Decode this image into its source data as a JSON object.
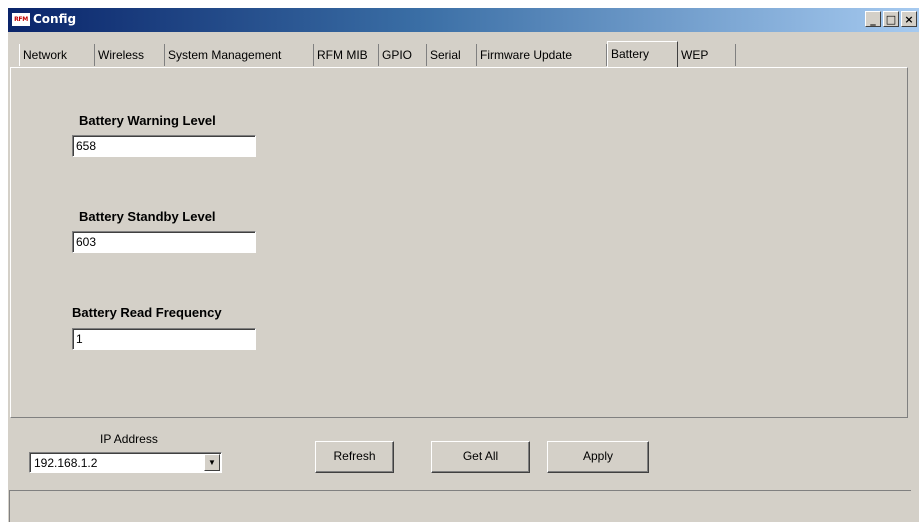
{
  "window": {
    "title": "Config",
    "app_icon_text": "RFM",
    "controls": {
      "minimize": "_",
      "maximize": "□",
      "close": "×"
    }
  },
  "tabs": [
    {
      "label": "Network",
      "active": false
    },
    {
      "label": "Wireless",
      "active": false
    },
    {
      "label": "System Management",
      "active": false
    },
    {
      "label": "RFM MIB",
      "active": false
    },
    {
      "label": "GPIO",
      "active": false
    },
    {
      "label": "Serial",
      "active": false
    },
    {
      "label": "Firmware Update",
      "active": false
    },
    {
      "label": "Battery",
      "active": true
    },
    {
      "label": "WEP",
      "active": false
    }
  ],
  "battery": {
    "warning": {
      "label": "Battery Warning Level",
      "value": "658"
    },
    "standby": {
      "label": "Battery Standby Level",
      "value": "603"
    },
    "frequency": {
      "label": "Battery Read Frequency",
      "value": "1"
    }
  },
  "footer": {
    "ip_label": "IP Address",
    "ip_value": "192.168.1.2",
    "dropdown_icon": "▼",
    "refresh_label": "Refresh",
    "get_all_label": "Get All",
    "apply_label": "Apply"
  },
  "colors": {
    "window_face": "#d4d0c8",
    "titlebar_start": "#0a246a",
    "titlebar_end": "#a6caf0"
  }
}
